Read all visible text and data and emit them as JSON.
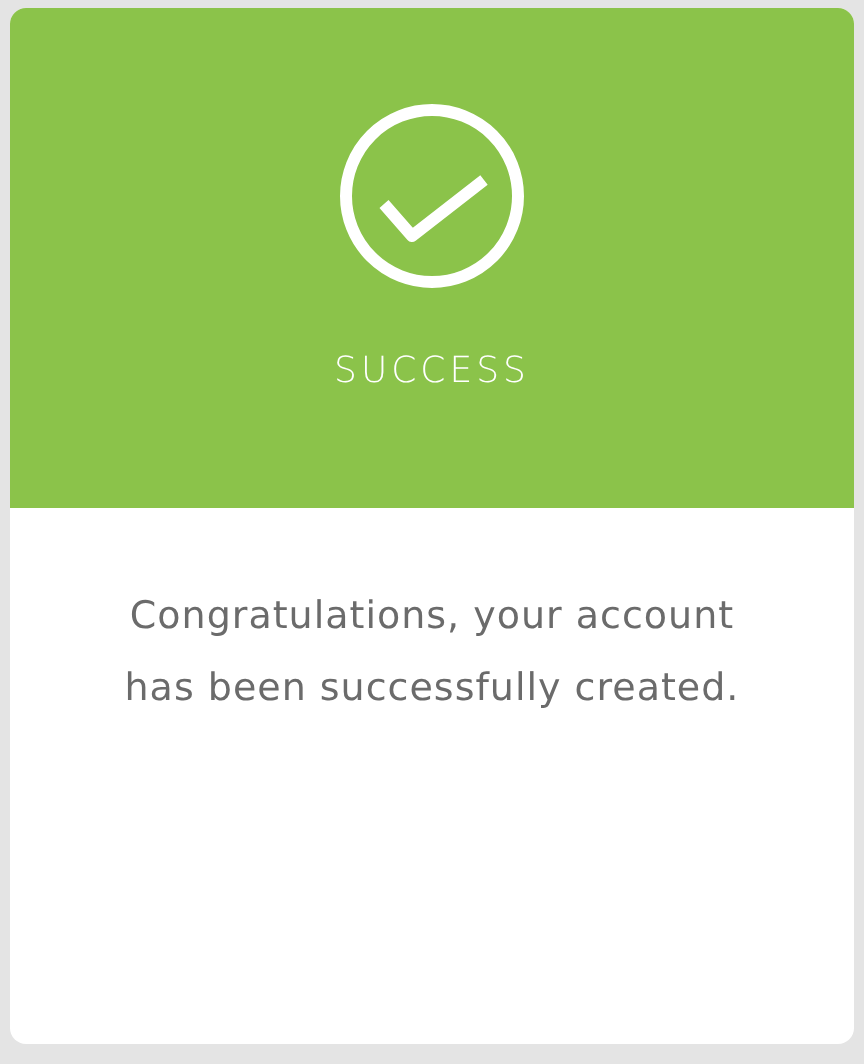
{
  "header": {
    "title": "SUCCESS"
  },
  "message": "Congratulations, your account has been successfully created."
}
